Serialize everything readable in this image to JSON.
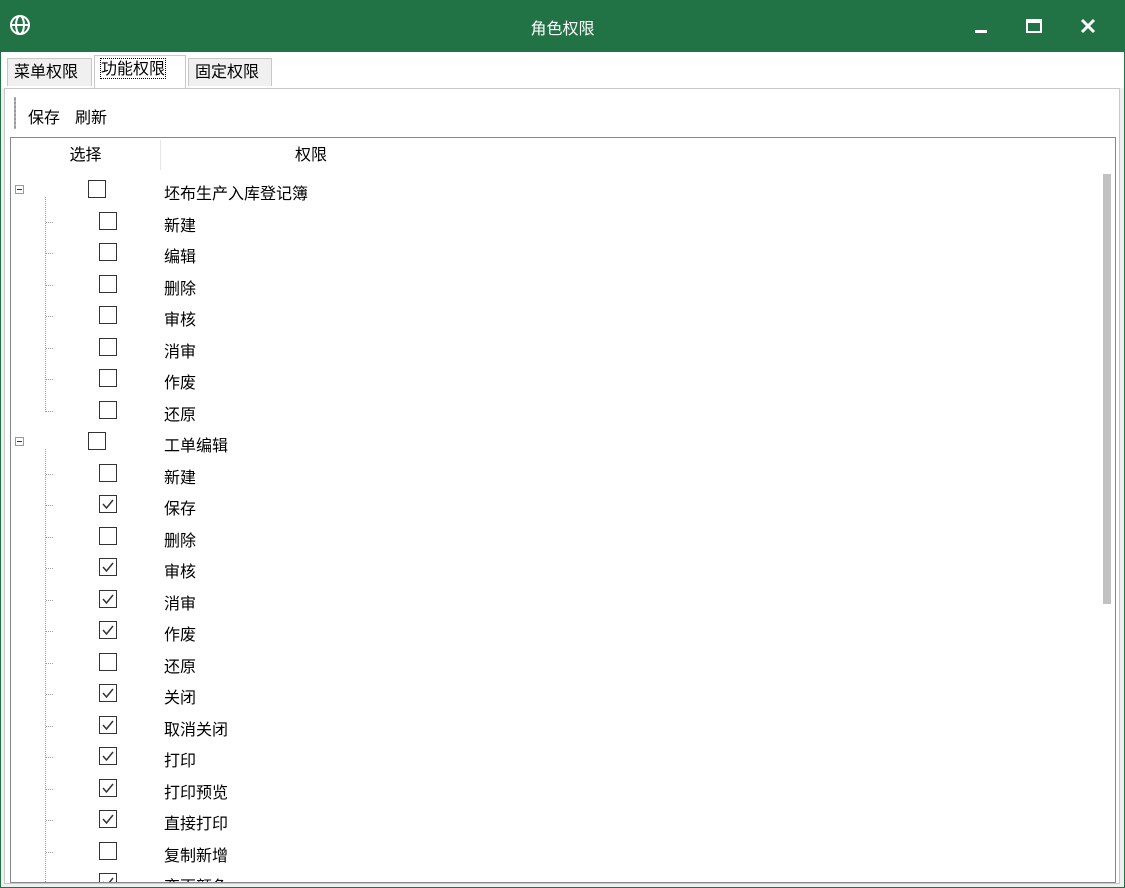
{
  "window": {
    "title": "角色权限",
    "accent_color": "#217346",
    "icons": {
      "app": "globe-icon",
      "minimize": "minimize-icon",
      "maximize": "maximize-icon",
      "close": "close-icon"
    }
  },
  "tabs": [
    {
      "label": "菜单权限",
      "active": false
    },
    {
      "label": "功能权限",
      "active": true
    },
    {
      "label": "固定权限",
      "active": false
    }
  ],
  "toolbar": {
    "save_label": "保存",
    "refresh_label": "刷新"
  },
  "grid": {
    "columns": {
      "select": "选择",
      "permission": "权限"
    },
    "groups": [
      {
        "label": "坯布生产入库登记簿",
        "expanded": true,
        "checked": false,
        "items": [
          {
            "label": "新建",
            "checked": false
          },
          {
            "label": "编辑",
            "checked": false
          },
          {
            "label": "删除",
            "checked": false
          },
          {
            "label": "审核",
            "checked": false
          },
          {
            "label": "消审",
            "checked": false
          },
          {
            "label": "作废",
            "checked": false
          },
          {
            "label": "还原",
            "checked": false
          }
        ]
      },
      {
        "label": "工单编辑",
        "expanded": true,
        "checked": false,
        "items": [
          {
            "label": "新建",
            "checked": false
          },
          {
            "label": "保存",
            "checked": true
          },
          {
            "label": "删除",
            "checked": false
          },
          {
            "label": "审核",
            "checked": true
          },
          {
            "label": "消审",
            "checked": true
          },
          {
            "label": "作废",
            "checked": true
          },
          {
            "label": "还原",
            "checked": false
          },
          {
            "label": "关闭",
            "checked": true
          },
          {
            "label": "取消关闭",
            "checked": true
          },
          {
            "label": "打印",
            "checked": true
          },
          {
            "label": "打印预览",
            "checked": true
          },
          {
            "label": "直接打印",
            "checked": true
          },
          {
            "label": "复制新增",
            "checked": false
          },
          {
            "label": "变更颜色",
            "checked": true
          }
        ]
      }
    ]
  }
}
